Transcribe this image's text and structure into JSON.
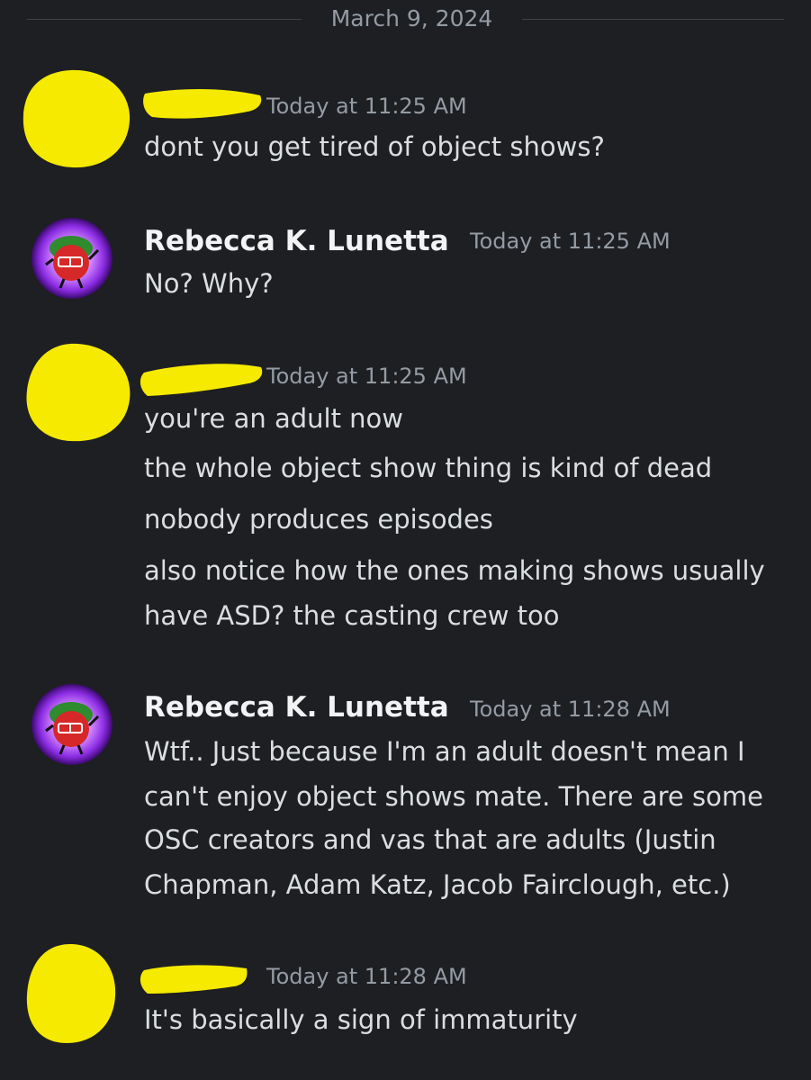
{
  "date_divider": "March 9, 2024",
  "colors": {
    "background": "#1e1f22",
    "redaction": "#f5ea00",
    "author_name": "#f2f3f5",
    "timestamp": "#949ba4",
    "message_text": "#dbdee1"
  },
  "messages": [
    {
      "author": "",
      "redacted": true,
      "timestamp": "Today at 11:25 AM",
      "lines": [
        "dont you get tired of object shows?"
      ]
    },
    {
      "author": "Rebecca K. Lunetta",
      "redacted": false,
      "avatar_icon": "tomato-character-avatar-icon",
      "timestamp": "Today at 11:25 AM",
      "lines": [
        "No? Why?"
      ]
    },
    {
      "author": "",
      "redacted": true,
      "timestamp": "Today at 11:25 AM",
      "lines": [
        "you're an adult now",
        "the whole object show thing is kind of dead",
        "nobody produces episodes",
        "also notice how the ones making shows usually",
        "have ASD? the casting crew too"
      ]
    },
    {
      "author": "Rebecca K. Lunetta",
      "redacted": false,
      "avatar_icon": "tomato-character-avatar-icon",
      "timestamp": "Today at 11:28 AM",
      "lines": [
        "Wtf.. Just because I'm an adult doesn't mean I",
        "can't enjoy object shows mate. There are some",
        "OSC creators and vas that are adults (Justin",
        "Chapman, Adam Katz, Jacob Fairclough, etc.)"
      ]
    },
    {
      "author": "",
      "redacted": true,
      "timestamp": "Today at 11:28 AM",
      "lines": [
        "It's basically a sign of immaturity"
      ]
    }
  ]
}
